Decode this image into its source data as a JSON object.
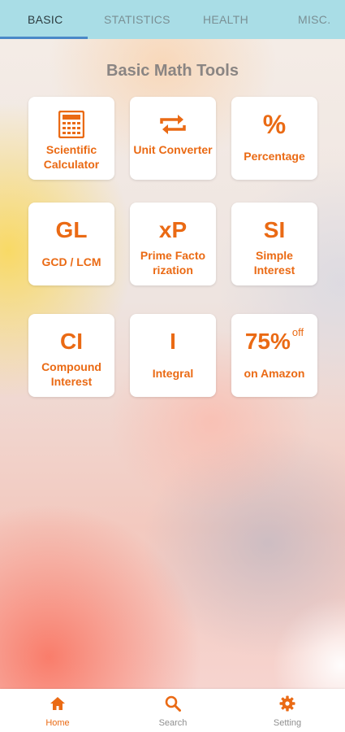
{
  "tabs": [
    {
      "label": "BASIC",
      "active": true
    },
    {
      "label": "STATISTICS",
      "active": false
    },
    {
      "label": "HEALTH",
      "active": false
    },
    {
      "label": "MISC.",
      "active": false
    }
  ],
  "page_title": "Basic Math Tools",
  "tools": [
    {
      "label": "Scientific Calculator",
      "icon": "calculator-icon"
    },
    {
      "label": "Unit Converter",
      "icon": "convert-arrows-icon"
    },
    {
      "label": "Percentage",
      "glyph": "%"
    },
    {
      "label": "GCD / LCM",
      "glyph": "GL"
    },
    {
      "label": "Prime Facto rization",
      "glyph": "xP"
    },
    {
      "label": "Simple Interest",
      "glyph": "SI"
    },
    {
      "label": "Compound Interest",
      "glyph": "CI"
    },
    {
      "label": "Integral",
      "glyph": "I"
    },
    {
      "label": "on Amazon",
      "glyph": "75%",
      "glyph_suffix": "off"
    }
  ],
  "bottom_nav": [
    {
      "label": "Home",
      "icon": "home-icon",
      "active": true
    },
    {
      "label": "Search",
      "icon": "search-icon",
      "active": false
    },
    {
      "label": "Setting",
      "icon": "gear-icon",
      "active": false
    }
  ],
  "colors": {
    "accent": "#ea6a14",
    "tabbar": "#a9dde6",
    "tab_indicator": "#4a88c8"
  }
}
